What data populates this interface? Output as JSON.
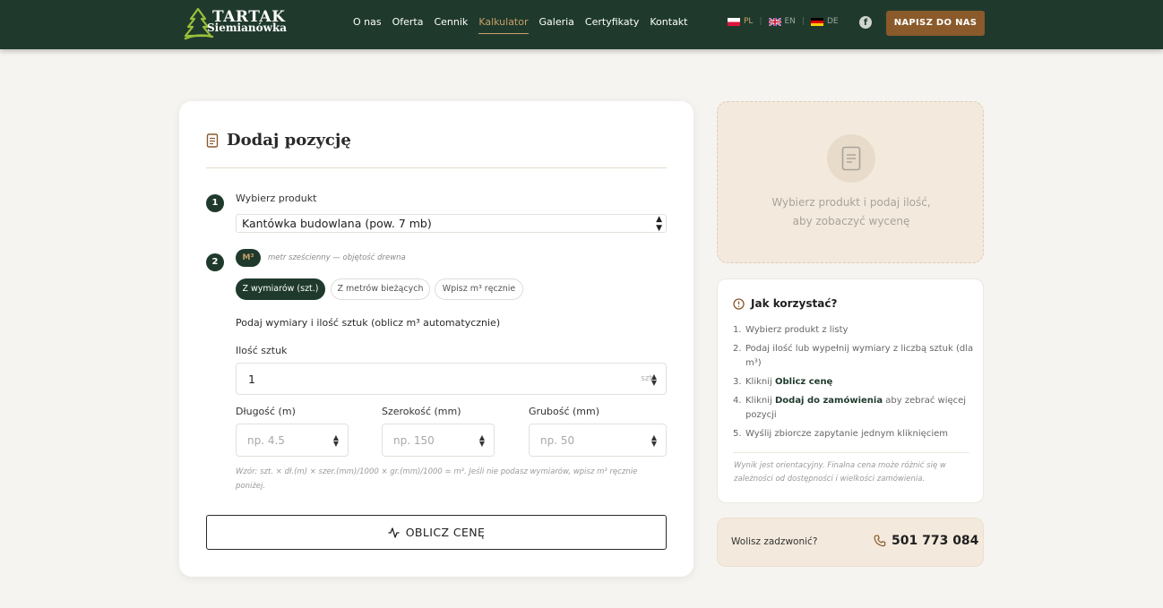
{
  "brand": {
    "name_line1": "TARTAK",
    "name_line2": "Siemianówka"
  },
  "nav": {
    "items": [
      {
        "label": "O nas"
      },
      {
        "label": "Oferta"
      },
      {
        "label": "Cennik"
      },
      {
        "label": "Kalkulator",
        "active": true
      },
      {
        "label": "Galeria"
      },
      {
        "label": "Certyfikaty"
      },
      {
        "label": "Kontakt"
      }
    ]
  },
  "languages": [
    {
      "code": "PL",
      "active": true
    },
    {
      "code": "EN"
    },
    {
      "code": "DE"
    }
  ],
  "header_cta": "NAPISZ DO NAS",
  "form": {
    "title": "Dodaj pozycję",
    "step1": {
      "number": "1",
      "label": "Wybierz produkt",
      "selected": "Kantówka budowlana (pow. 7 mb)"
    },
    "step2": {
      "number": "2",
      "unit_badge": "M³",
      "unit_hint": "metr sześcienny — objętość drewna",
      "tabs": [
        "Z wymiarów (szt.)",
        "Z metrów bieżących",
        "Wpisz m³ ręcznie"
      ],
      "active_tab": 0,
      "subheading": "Podaj wymiary i ilość sztuk (oblicz m³ automatycznie)",
      "quantity_label": "Ilość sztuk",
      "quantity_value": "1",
      "quantity_unit": "szt.",
      "length_label": "Długość (m)",
      "length_placeholder": "np. 4.5",
      "width_label": "Szerokość (mm)",
      "width_placeholder": "np. 150",
      "thickness_label": "Grubość (mm)",
      "thickness_placeholder": "np. 50",
      "formula": "Wzór: szt. × dł.(m) × szer.(mm)/1000 × gr.(mm)/1000 = m³. Jeśli nie podasz wymiarów, wpisz m³ ręcznie poniżej."
    },
    "calc_button": "OBLICZ CENĘ"
  },
  "preview": {
    "line1": "Wybierz produkt i podaj ilość,",
    "line2": "aby zobaczyć wycenę"
  },
  "howto": {
    "title": "Jak korzystać?",
    "steps": [
      {
        "n": "1.",
        "pre": "Wybierz produkt z listy",
        "bold": "",
        "post": ""
      },
      {
        "n": "2.",
        "pre": "Podaj ilość lub wypełnij wymiary z liczbą sztuk (dla m³)",
        "bold": "",
        "post": ""
      },
      {
        "n": "3.",
        "pre": "Kliknij ",
        "bold": "Oblicz cenę",
        "post": ""
      },
      {
        "n": "4.",
        "pre": "Kliknij ",
        "bold": "Dodaj do zamówienia",
        "post": " aby zebrać więcej pozycji"
      },
      {
        "n": "5.",
        "pre": "Wyślij zbiorcze zapytanie jednym kliknięciem",
        "bold": "",
        "post": ""
      }
    ],
    "note": "Wynik jest orientacyjny. Finalna cena może różnić się w zależności od dostępności i wielkości zamówienia."
  },
  "call": {
    "label": "Wolisz zadzwonić?",
    "phone": "501 773 084"
  },
  "colors": {
    "primary": "#1f3a2c",
    "accent": "#c9a06a",
    "cta": "#8a5a2b"
  }
}
